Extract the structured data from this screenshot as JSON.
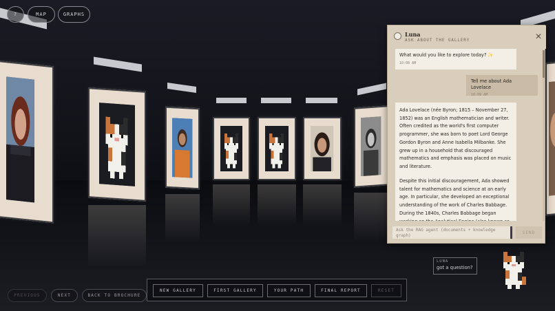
{
  "top_buttons": {
    "help": "?",
    "map": "MAP",
    "graphs": "GRAPHS"
  },
  "chat": {
    "agent_name": "Luna",
    "subtitle": "ASK ABOUT THE GALLERY",
    "close": "✕",
    "messages": [
      {
        "role": "agent",
        "text": "What would you like to explore today? ✨",
        "time": "10:08 AM"
      },
      {
        "role": "user",
        "text": "Tell me about Ada Lovelace",
        "time": "10:09 AM"
      }
    ],
    "answer_paragraphs": [
      "Ada Lovelace (née Byron; 1815 – November 27, 1852) was an English mathematician and writer. Often credited as the world's first computer programmer, she was born to poet Lord George Gordon Byron and Anne Isabella Milbanke. She grew up in a household that discouraged mathematics and emphasis was placed on music and literature.",
      "Despite this initial discouragement, Ada showed talent for mathematics and science at an early age. In particular, she developed an exceptional understanding of the work of Charles Babbage. During the 1840s, Charles Babbage began working on the Analytical Engine (also known as"
    ],
    "input_placeholder": "Ask the RAG agent (documents + knowledge graph)",
    "send_label": "SEND"
  },
  "bottom_nav": {
    "previous": "PREVIOUS",
    "next": "NEXT",
    "back": "BACK TO BROCHURE",
    "new_gallery": "NEW GALLERY",
    "first_gallery": "FIRST GALLERY",
    "your_path": "YOUR PATH",
    "final_report": "FINAL REPORT",
    "reset": "RESET"
  },
  "mascot": {
    "name": "LUNA",
    "prompt": "got a question?"
  },
  "colors": {
    "panel_bg": "#d9cebc",
    "user_bubble": "#c9bba6",
    "agent_bubble": "#f4efe6",
    "frame_mat": "#e7dccd",
    "scene_bg": "#0f1016"
  }
}
